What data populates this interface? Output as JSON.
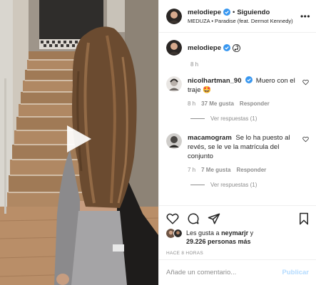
{
  "header": {
    "username": "melodiepe",
    "separator": "•",
    "follow_label": "Siguiendo",
    "audio": "MEDUZA • Paradise (feat. Dermot Kennedy)",
    "more_label": "•••"
  },
  "caption": {
    "username": "melodiepe",
    "time": "8 h"
  },
  "comments": [
    {
      "username": "nicolhartman_90",
      "text": "Muero con el traje 🤩",
      "time": "8 h",
      "likes": "37 Me gusta",
      "reply_label": "Responder",
      "view_replies": "Ver respuestas (1)"
    },
    {
      "username": "macamogram",
      "text": "Se lo ha puesto al revés, se le ve la matrícula del conjunto",
      "time": "7 h",
      "likes": "7 Me gusta",
      "reply_label": "Responder",
      "view_replies": "Ver respuestas (1)"
    }
  ],
  "likes": {
    "prefix": "Les gusta a",
    "liker": "neymarjr",
    "conj": "y",
    "count": "29.226 personas más"
  },
  "age": "HACE 8 HORAS",
  "compose": {
    "placeholder": "Añade un comentario...",
    "post_label": "Publicar"
  },
  "colors": {
    "verified": "#3897f0",
    "muted": "#8e8e8e",
    "post_disabled": "#b3dbff",
    "text": "#262626"
  },
  "icons": {
    "play": "play-icon",
    "verified": "verified-badge-icon",
    "music": "music-note-icon",
    "heart": "heart-icon",
    "comment": "comment-icon",
    "share": "share-icon",
    "save": "bookmark-icon"
  }
}
